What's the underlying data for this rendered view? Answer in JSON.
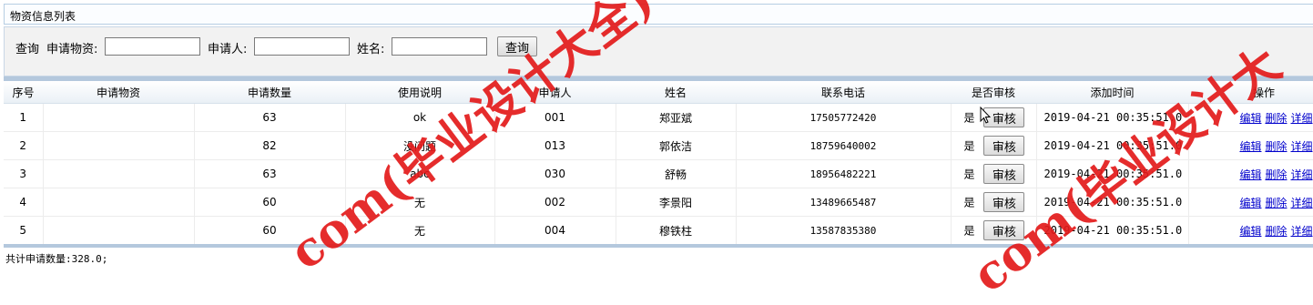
{
  "header": {
    "title": "物资信息列表"
  },
  "search": {
    "section_label": "查询",
    "material_label": "申请物资:",
    "material_value": "",
    "applicant_label": "申请人:",
    "applicant_value": "",
    "name_label": "姓名:",
    "name_value": "",
    "button_label": "查询"
  },
  "table": {
    "columns": [
      "序号",
      "申请物资",
      "申请数量",
      "使用说明",
      "申请人",
      "姓名",
      "联系电话",
      "是否审核",
      "添加时间",
      "操作"
    ],
    "rows": [
      {
        "index": "1",
        "material": "",
        "quantity": "63",
        "usage": "ok",
        "applicant": "001",
        "name": "郑亚斌",
        "phone": "17505772420",
        "audited": "是",
        "audit_button": "审核",
        "time": "2019-04-21 00:35:51.0",
        "op_edit": "编辑",
        "op_delete": "删除",
        "op_detail": "详细"
      },
      {
        "index": "2",
        "material": "",
        "quantity": "82",
        "usage": "没问题",
        "applicant": "013",
        "name": "郭依洁",
        "phone": "18759640002",
        "audited": "是",
        "audit_button": "审核",
        "time": "2019-04-21 00:35:51.0",
        "op_edit": "编辑",
        "op_delete": "删除",
        "op_detail": "详细"
      },
      {
        "index": "3",
        "material": "",
        "quantity": "63",
        "usage": "abc",
        "applicant": "030",
        "name": "舒畅",
        "phone": "18956482221",
        "audited": "是",
        "audit_button": "审核",
        "time": "2019-04-21 00:35:51.0",
        "op_edit": "编辑",
        "op_delete": "删除",
        "op_detail": "详细"
      },
      {
        "index": "4",
        "material": "",
        "quantity": "60",
        "usage": "无",
        "applicant": "002",
        "name": "李景阳",
        "phone": "13489665487",
        "audited": "是",
        "audit_button": "审核",
        "time": "2019-04-21 00:35:51.0",
        "op_edit": "编辑",
        "op_delete": "删除",
        "op_detail": "详细"
      },
      {
        "index": "5",
        "material": "",
        "quantity": "60",
        "usage": "无",
        "applicant": "004",
        "name": "穆铁柱",
        "phone": "13587835380",
        "audited": "是",
        "audit_button": "审核",
        "time": "2019-04-21 00:35:51.0",
        "op_edit": "编辑",
        "op_delete": "删除",
        "op_detail": "详细"
      }
    ]
  },
  "footer": {
    "total": "共计申请数量:328.0;"
  },
  "watermarks": [
    "com(毕业设计大全)",
    "com(毕业设计大"
  ],
  "colors": {
    "accent_bar": "#b4c8dd",
    "link": "#0000cc",
    "watermark": "#e31b1b"
  }
}
